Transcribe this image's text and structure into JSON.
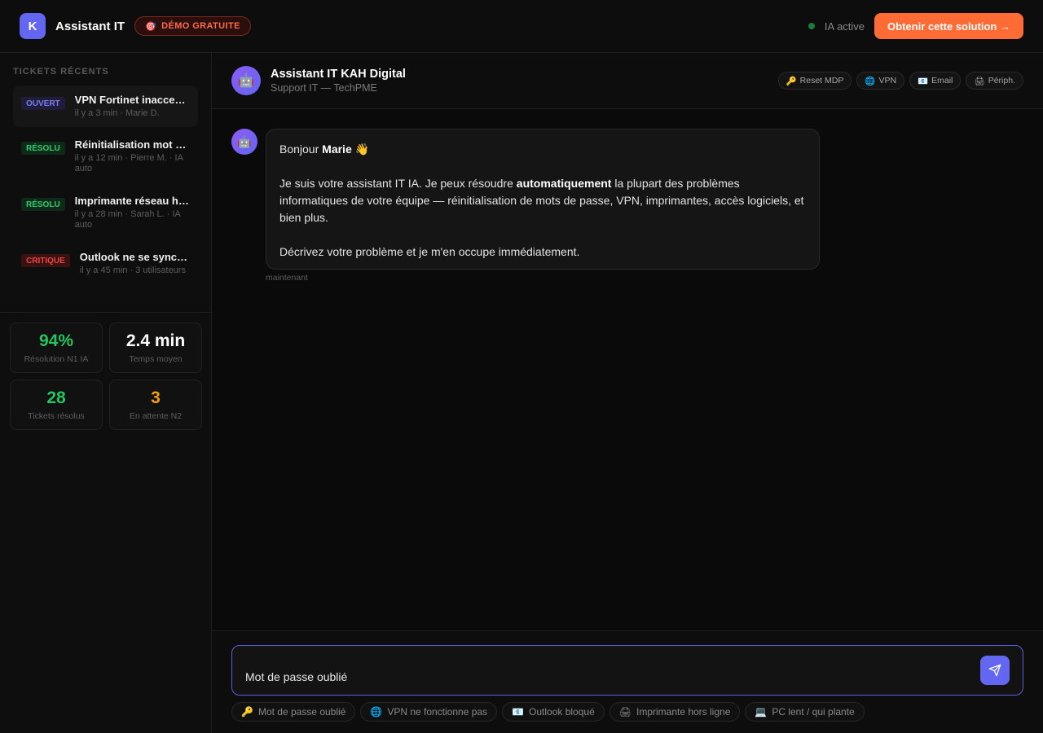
{
  "header": {
    "logo_letter": "K",
    "app_title": "Assistant IT",
    "demo_badge_icon": "🎯",
    "demo_badge": "DÉMO GRATUITE",
    "status_text": "IA active",
    "cta_label": "Obtenir cette solution →"
  },
  "sidebar": {
    "heading": "TICKETS RÉCENTS",
    "tickets": [
      {
        "tag": "OUVERT",
        "title": "VPN Fortinet inaccessible",
        "meta": "il y a 3 min · Marie D."
      },
      {
        "tag": "RÉSOLU",
        "title": "Réinitialisation mot de passe",
        "meta": "il y a 12 min · Pierre M. · IA auto"
      },
      {
        "tag": "RÉSOLU",
        "title": "Imprimante réseau hors ligne",
        "meta": "il y a 28 min · Sarah L. · IA auto"
      },
      {
        "tag": "CRITIQUE",
        "title": "Outlook ne se synchronise plus",
        "meta": "il y a 45 min · 3 utilisateurs"
      }
    ],
    "stats": [
      {
        "value": "94%",
        "label": "Résolution N1 IA",
        "color": "#22c55e"
      },
      {
        "value": "2.4 min",
        "label": "Temps moyen",
        "color": "#ffffff"
      },
      {
        "value": "28",
        "label": "Tickets résolus",
        "color": "#22c55e"
      },
      {
        "value": "3",
        "label": "En attente N2",
        "color": "#f59e0b"
      }
    ]
  },
  "chat": {
    "bot_avatar": "🤖",
    "bot_name": "Assistant IT KAH Digital",
    "bot_subtitle": "Support IT — TechPME",
    "top_chips": [
      {
        "icon": "🔑",
        "label": "Reset MDP"
      },
      {
        "icon": "🌐",
        "label": "VPN"
      },
      {
        "icon": "📧",
        "label": "Email"
      },
      {
        "icon": "🖨",
        "label": "Périph."
      }
    ],
    "message": {
      "greeting_prefix": "Bonjour ",
      "greeting_name": "Marie",
      "greeting_emoji": " 👋",
      "p1_prefix": "Je suis votre assistant IT IA. Je peux résoudre ",
      "p1_bold": "automatiquement",
      "p1_suffix": " la plupart des problèmes informatiques de votre équipe — réinitialisation de mots de passe, VPN, imprimantes, accès logiciels, et bien plus.",
      "p2": "Décrivez votre problème et je m'en occupe immédiatement.",
      "time": "maintenant"
    },
    "input_value": "Mot de passe oublié",
    "quick_replies": [
      {
        "icon": "🔑",
        "label": "Mot de passe oublié"
      },
      {
        "icon": "🌐",
        "label": "VPN ne fonctionne pas"
      },
      {
        "icon": "📧",
        "label": "Outlook bloqué"
      },
      {
        "icon": "🖨",
        "label": "Imprimante hors ligne"
      },
      {
        "icon": "💻",
        "label": "PC lent / qui plante"
      }
    ]
  }
}
